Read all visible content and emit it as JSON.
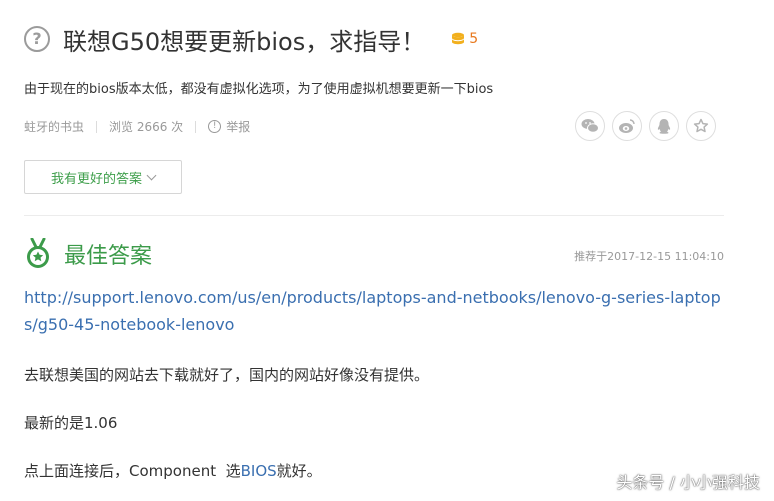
{
  "question": {
    "title": "联想G50想要更新bios，求指导！",
    "reward": "5",
    "description": "由于现在的bios版本太低，都没有虚拟化选项，为了使用虚拟机想要更新一下bios",
    "author": "蛀牙的书虫",
    "views": "浏览 2666 次",
    "report": "举报"
  },
  "share_icons": [
    "wechat-icon",
    "weibo-icon",
    "qq-icon",
    "star-icon"
  ],
  "better_answer_button": "我有更好的答案",
  "best_answer": {
    "title": "最佳答案",
    "recommended_time": "推荐于2017-12-15 11:04:10",
    "link": "http://support.lenovo.com/us/en/products/laptops-and-netbooks/lenovo-g-series-laptops/g50-45-notebook-lenovo",
    "p1": "去联想美国的网站去下载就好了，国内的网站好像没有提供。",
    "p2": "最新的是1.06",
    "p3_prefix": "点上面连接后，Component  选",
    "p3_link": "BIOS",
    "p3_suffix": "就好。"
  },
  "watermark": "头条号 / 小小强科技",
  "colors": {
    "green": "#3c9b4a",
    "link": "#3a6fb0",
    "reward": "#e8791f"
  }
}
